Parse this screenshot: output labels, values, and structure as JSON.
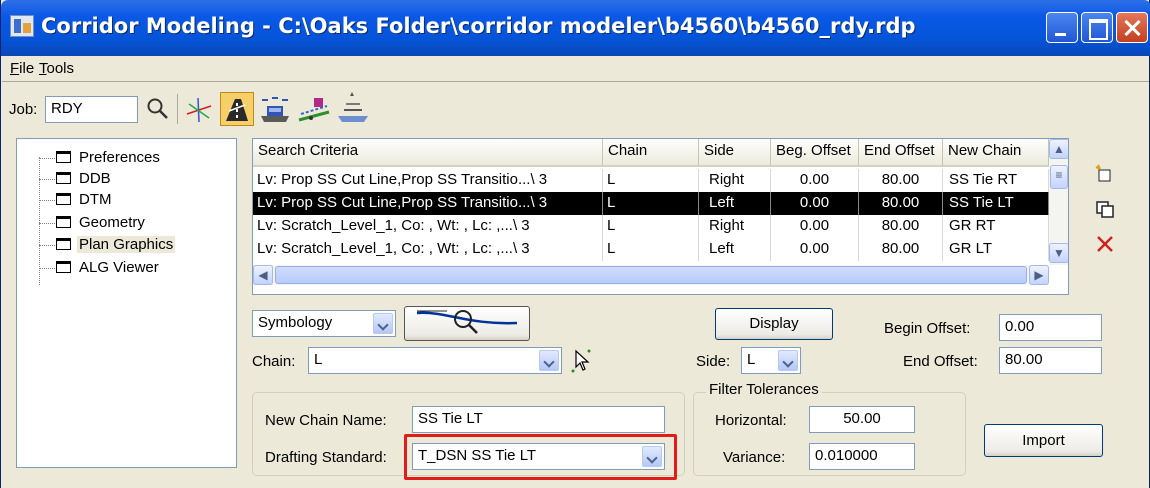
{
  "window": {
    "title": "Corridor Modeling - C:\\Oaks Folder\\corridor modeler\\b4560\\b4560_rdy.rdp"
  },
  "menu": {
    "file": "File",
    "tools": "Tools"
  },
  "toolbar": {
    "job_label": "Job:",
    "job_value": "RDY",
    "icons": [
      "search-icon",
      "axis-icon",
      "corridor-icon",
      "road-icon",
      "transition-icon",
      "template-icon"
    ]
  },
  "tree": {
    "items": [
      {
        "label": "Preferences"
      },
      {
        "label": "DDB"
      },
      {
        "label": "DTM"
      },
      {
        "label": "Geometry"
      },
      {
        "label": "Plan Graphics"
      },
      {
        "label": "ALG Viewer"
      }
    ]
  },
  "grid": {
    "columns": [
      "Search Criteria",
      "Chain",
      "Side",
      "Beg. Offset",
      "End Offset",
      "New Chain"
    ],
    "rows": [
      {
        "criteria": "Lv: Prop SS Cut Line,Prop SS Transitio...\\ 3",
        "chain": "L",
        "side": "Right",
        "beg": "0.00",
        "end": "80.00",
        "newchain": "SS Tie RT"
      },
      {
        "criteria": "Lv: Prop SS Cut Line,Prop SS Transitio...\\ 3",
        "chain": "L",
        "side": "Left",
        "beg": "0.00",
        "end": "80.00",
        "newchain": "SS Tie LT"
      },
      {
        "criteria": "Lv: Scratch_Level_1, Co: , Wt: , Lc: ,...\\ 3",
        "chain": "L",
        "side": "Right",
        "beg": "0.00",
        "end": "80.00",
        "newchain": "GR RT"
      },
      {
        "criteria": "Lv: Scratch_Level_1, Co: , Wt: , Lc: ,...\\ 3",
        "chain": "L",
        "side": "Left",
        "beg": "0.00",
        "end": "80.00",
        "newchain": "GR LT"
      }
    ]
  },
  "controls": {
    "symbology": "Symbology",
    "display": "Display",
    "begin_offset_label": "Begin Offset:",
    "begin_offset": "0.00",
    "end_offset_label": "End Offset:",
    "end_offset": "80.00",
    "chain_label": "Chain:",
    "chain_value": "L",
    "side_label": "Side:",
    "side_value": "L"
  },
  "new_chain": {
    "name_label": "New Chain Name:",
    "name_value": "SS Tie LT",
    "drafting_label": "Drafting Standard:",
    "drafting_value": "T_DSN SS Tie LT"
  },
  "filter": {
    "title": "Filter Tolerances",
    "horizontal_label": "Horizontal:",
    "horizontal": "50.00",
    "variance_label": "Variance:",
    "variance": "0.010000"
  },
  "import": "Import",
  "colors": {
    "title_bar": "#0a58e6",
    "highlight": "#e21b1b",
    "selected_row": "#000000"
  }
}
